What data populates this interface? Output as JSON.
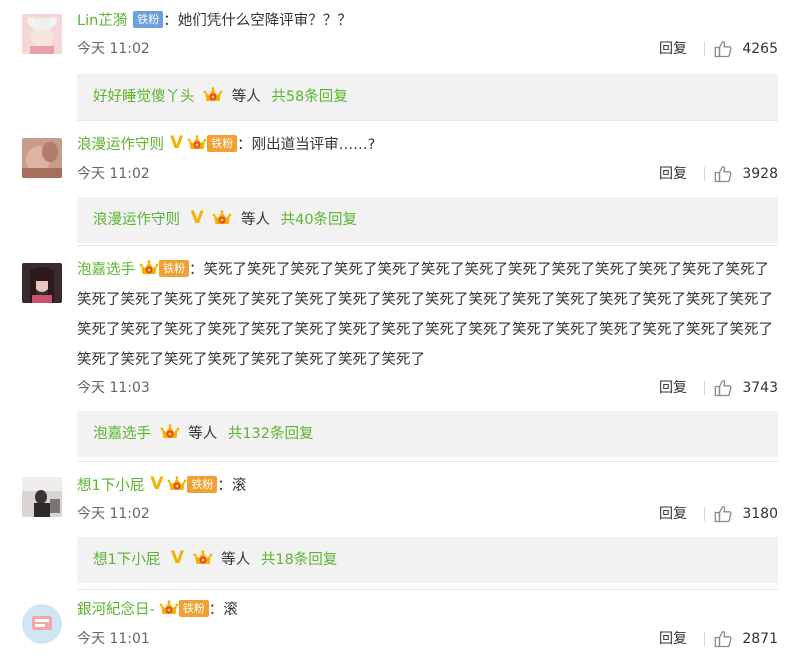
{
  "comments": [
    {
      "username": "Lin芷漪",
      "badge": "铁粉",
      "text": "她们凭什么空降评审？？？",
      "time": "今天 11:02",
      "reply_label": "回复",
      "likes": "4265",
      "sub_user": "好好睡觉傻丫头",
      "sub_deng": "等人",
      "sub_total": "共58条回复"
    },
    {
      "username": "浪漫运作守则",
      "badge": "铁粉",
      "text": "刚出道当评审……?",
      "time": "今天 11:02",
      "reply_label": "回复",
      "likes": "3928",
      "sub_user": "浪漫运作守则",
      "sub_deng": "等人",
      "sub_total": "共40条回复"
    },
    {
      "username": "泡嘉选手",
      "badge": "铁粉",
      "text": "笑死了笑死了笑死了笑死了笑死了笑死了笑死了笑死了笑死了笑死了笑死了笑死了笑死了笑死了笑死了笑死了笑死了笑死了笑死了笑死了笑死了笑死了笑死了笑死了笑死了笑死了笑死了笑死了笑死了笑死了笑死了笑死了笑死了笑死了笑死了笑死了笑死了笑死了笑死了笑死了笑死了笑死了笑死了笑死了笑死了笑死了笑死了笑死了笑死了笑死了笑死了笑死了笑死了",
      "time": "今天 11:03",
      "reply_label": "回复",
      "likes": "3743",
      "sub_user": "泡嘉选手",
      "sub_deng": "等人",
      "sub_total": "共132条回复"
    },
    {
      "username": "想1下小屁",
      "badge": "铁粉",
      "text": "滚",
      "time": "今天 11:02",
      "reply_label": "回复",
      "likes": "3180",
      "sub_user": "想1下小屁",
      "sub_deng": "等人",
      "sub_total": "共18条回复"
    },
    {
      "username": "銀河紀念日-",
      "badge": "铁粉",
      "text": "滚",
      "time": "今天 11:01",
      "reply_label": "回复",
      "likes": "2871"
    }
  ],
  "colors": {
    "username": "#5ab52f",
    "badge_blue": "#6a9fe0",
    "badge_orange": "#f0a131",
    "verified": "#f2b200",
    "sub_bg": "#f2f2f2"
  },
  "icons": [
    "thumb-up-icon",
    "crown-badge-icon",
    "verified-icon"
  ]
}
